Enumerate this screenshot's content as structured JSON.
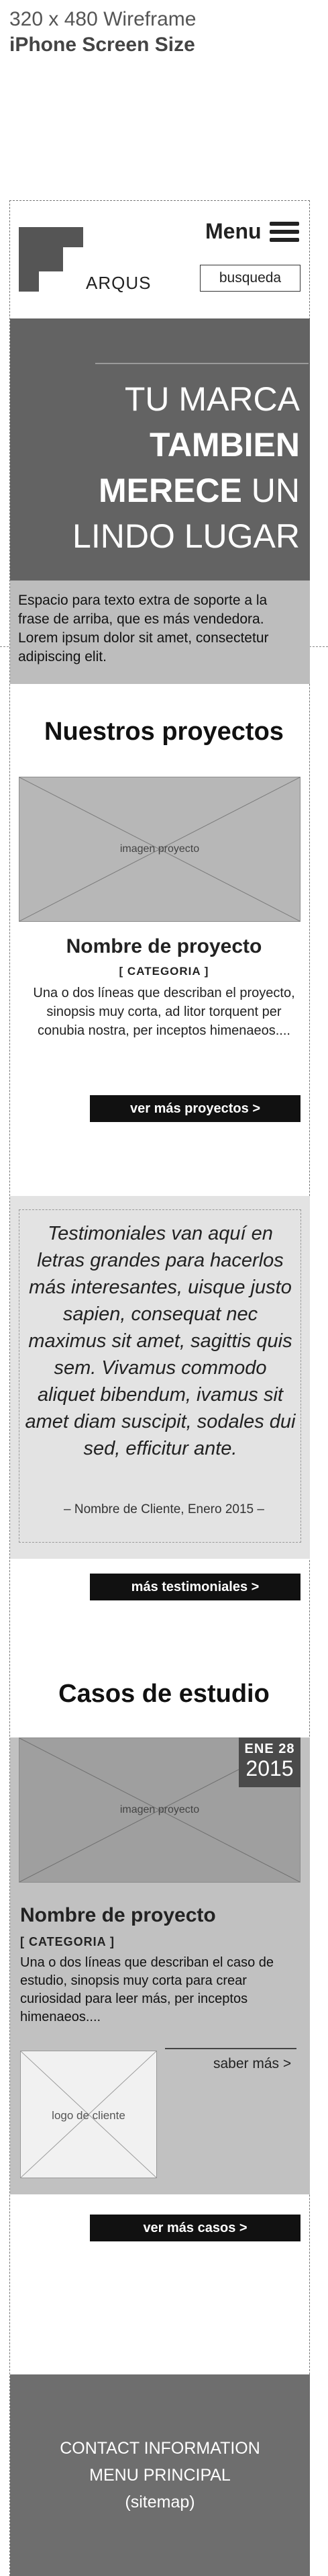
{
  "wireframe": {
    "title_line1": "320 x 480 Wireframe",
    "title_line2": "iPhone Screen Size"
  },
  "header": {
    "logo_text": "ARQUS",
    "menu_label": "Menu",
    "search_label": "busqueda"
  },
  "hero": {
    "line1": "TU MARCA",
    "line2": "TAMBIEN",
    "line3_bold": "MERECE",
    "line3_rest": " UN",
    "line4": "LINDO LUGAR",
    "subtext": "Espacio para texto extra de soporte a la frase de arriba, que es más vendedora. Lorem ipsum dolor sit amet, consectetur adipiscing elit."
  },
  "projects": {
    "heading": "Nuestros proyectos",
    "image_label": "imagen proyecto",
    "name": "Nombre de proyecto",
    "category": "[ CATEGORIA ]",
    "description": "Una o dos líneas que describan el proyecto, sinopsis muy corta, ad litor torquent per conubia nostra, per inceptos himenaeos....",
    "more_button": "ver más proyectos >"
  },
  "testimonials": {
    "quote": "Testimoniales van aquí en letras grandes para hacerlos más interesantes, uisque justo sapien, consequat nec maximus sit amet, sagittis quis sem. Vivamus commodo aliquet bibendum, ivamus sit amet diam suscipit, sodales dui sed, efficitur ante.",
    "author": "– Nombre de Cliente, Enero 2015 –",
    "more_button": "más testimoniales >"
  },
  "cases": {
    "heading": "Casos de estudio",
    "image_label": "imagen proyecto",
    "date_month": "ENE 28",
    "date_year": "2015",
    "name": "Nombre de proyecto",
    "category": "[ CATEGORIA ]",
    "description": "Una o dos líneas que describan el caso de estudio, sinopsis muy corta para crear curiosidad para leer más, per inceptos himenaeos....",
    "client_logo_label": "logo de cliente",
    "read_more": "saber más >",
    "more_button": "ver más casos >"
  },
  "footer": {
    "line1": "CONTACT INFORMATION",
    "line2": "MENU PRINCIPAL",
    "line3": "(sitemap)"
  }
}
